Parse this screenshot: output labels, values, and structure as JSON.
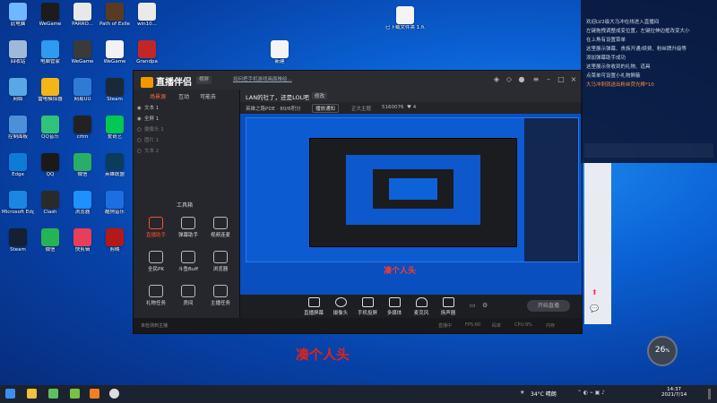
{
  "desktop_icons": [
    {
      "label": "此电脑",
      "color": "#6fb7ff",
      "col": 0,
      "row": 0
    },
    {
      "label": "WeGame",
      "color": "#1c1c1c",
      "col": 1,
      "row": 0
    },
    {
      "label": "PARRO...",
      "color": "#e8e8e8",
      "col": 2,
      "row": 0
    },
    {
      "label": "Path of Exile",
      "color": "#5a3b22",
      "col": 3,
      "row": 0
    },
    {
      "label": "win10...",
      "color": "#eaeaea",
      "col": 4,
      "row": 0
    },
    {
      "label": "回收站",
      "color": "#9fb9d8",
      "col": 0,
      "row": 1
    },
    {
      "label": "电脑管家",
      "color": "#2c9bf0",
      "col": 1,
      "row": 1
    },
    {
      "label": "WeGame",
      "color": "#3a3a3a",
      "col": 2,
      "row": 1
    },
    {
      "label": "WeGame",
      "color": "#f2f2f2",
      "col": 3,
      "row": 1
    },
    {
      "label": "Grandpa",
      "color": "#c32626",
      "col": 4,
      "row": 1
    },
    {
      "label": "网络",
      "color": "#5aa7e6",
      "col": 0,
      "row": 2
    },
    {
      "label": "雷电模拟器",
      "color": "#f2b616",
      "col": 1,
      "row": 2
    },
    {
      "label": "网易UU",
      "color": "#2e7bd6",
      "col": 2,
      "row": 2
    },
    {
      "label": "Steam",
      "color": "#1b2838",
      "col": 3,
      "row": 2
    },
    {
      "label": "控制面板",
      "color": "#4d8fd8",
      "col": 0,
      "row": 3
    },
    {
      "label": "QQ音乐",
      "color": "#31c27c",
      "col": 1,
      "row": 3
    },
    {
      "label": "crtm",
      "color": "#222",
      "col": 2,
      "row": 3
    },
    {
      "label": "爱奇艺",
      "color": "#00c853",
      "col": 3,
      "row": 3
    },
    {
      "label": "Edge",
      "color": "#0f7bd8",
      "col": 0,
      "row": 4
    },
    {
      "label": "QQ",
      "color": "#1a1a1a",
      "col": 1,
      "row": 4
    },
    {
      "label": "微信",
      "color": "#2aae67",
      "col": 2,
      "row": 4
    },
    {
      "label": "英雄联盟",
      "color": "#0b3c5d",
      "col": 3,
      "row": 4
    },
    {
      "label": "Microsoft Edge",
      "color": "#1a87e2",
      "col": 0,
      "row": 5
    },
    {
      "label": "Clash",
      "color": "#2a2a2a",
      "col": 1,
      "row": 5
    },
    {
      "label": "浏览器",
      "color": "#1e90ff",
      "col": 2,
      "row": 5
    },
    {
      "label": "酷狗音乐",
      "color": "#1c6fe0",
      "col": 3,
      "row": 5
    },
    {
      "label": "Steam",
      "color": "#142033",
      "col": 0,
      "row": 6
    },
    {
      "label": "微信",
      "color": "#26b357",
      "col": 1,
      "row": 6
    },
    {
      "label": "快剪辑",
      "color": "#e83e5c",
      "col": 2,
      "row": 6
    },
    {
      "label": "剪映",
      "color": "#b31919",
      "col": 3,
      "row": 6
    }
  ],
  "desktop_extra": {
    "file1": "已下载文件夹 1.fuckout",
    "file2": "新建"
  },
  "window": {
    "app_name": "直播伴侣",
    "mode_chip": "横屏",
    "notice": "如何把手机游戏画面推给...",
    "tabs": [
      "场景源",
      "互动",
      "可能去"
    ],
    "scene_rows": [
      "文本 1",
      "全屏 1",
      "摄像头 1",
      "图片 1",
      "文本 2"
    ],
    "tools_label": "工具箱",
    "tools": [
      {
        "label": "直播助手",
        "active": true
      },
      {
        "label": "弹幕助手",
        "active": false
      },
      {
        "label": "视频连麦",
        "active": false
      },
      {
        "label": "全民PK",
        "active": false
      },
      {
        "label": "斗鱼Buff",
        "active": false
      },
      {
        "label": "浏览器",
        "active": false
      },
      {
        "label": "礼物任务",
        "active": false
      },
      {
        "label": "房间",
        "active": false
      },
      {
        "label": "主播任务",
        "active": false
      }
    ],
    "live_title": "LAN的社了，还是LOL吧",
    "title_chip": "修改",
    "info_line": "英雄之路PDE · 80/6积分",
    "info_btn": "播放通知",
    "room_label": "正大主题",
    "room_id": "5160076",
    "likes": "4",
    "preview_caption": "凑个人头",
    "bottom_buttons": [
      "直播屏幕",
      "摄像头",
      "手机投屏",
      "多媒体",
      "麦克风",
      "扬声器"
    ],
    "start_button": "开始直播",
    "status_left": "未检测到主播",
    "status_items": [
      "直播中",
      "FPS:60",
      "码率",
      "CPU:9%",
      "内存"
    ]
  },
  "overlay_caption": "凑个人头",
  "chat": {
    "lines": [
      "欢迎LV2级大马冲在线进入直播间",
      "左键拖拽调整成变位置，左键拉伸边框改变大小",
      "在上角有设置菜单",
      "这里展示弹幕、贵族开通/续费、粉丝牌升级等",
      "添加弹幕助手成功",
      "这里展示你收到的礼物、道具",
      "点菜单可设置小礼物屏蔽",
      "大马冲刺就送出粉丝荧光棒*10"
    ],
    "highlight_line": "大马冲刺就送出粉丝荧光棒*10"
  },
  "gauge": {
    "value": "26",
    "unit": "%"
  },
  "taskbar": {
    "weather": "34°C 晴朗",
    "time": "14:37",
    "date": "2021/7/14"
  }
}
